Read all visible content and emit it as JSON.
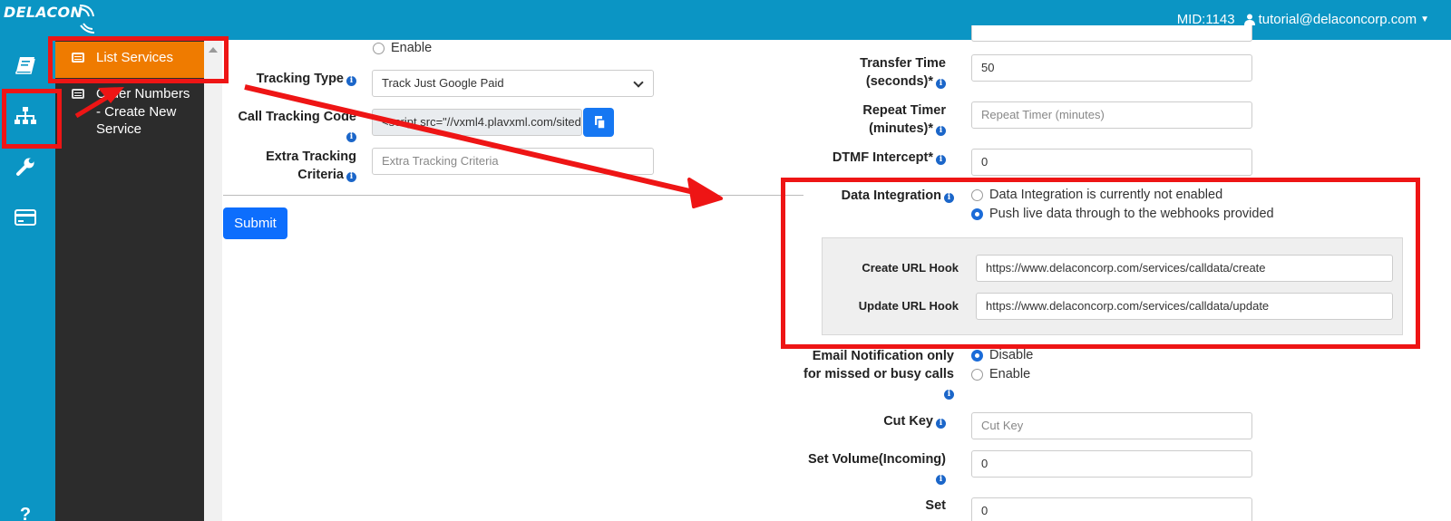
{
  "header": {
    "logo_text": "DELACON",
    "merchant_id": "MID:1143",
    "user_email": "tutorial@delaconcorp.com"
  },
  "rail": {
    "icons": [
      "book-icon",
      "sitemap-icon",
      "wrench-icon",
      "credit-card-icon",
      "help-icon"
    ]
  },
  "submenu": {
    "items": [
      {
        "label": "List Services",
        "active": true
      },
      {
        "label": "Order Numbers - Create New Service",
        "active": false
      }
    ]
  },
  "form_left": {
    "enable_option": "Enable",
    "tracking_type": {
      "label": "Tracking Type",
      "value": "Track Just Google Paid"
    },
    "call_tracking_code": {
      "label": "Call Tracking Code",
      "value": "<script src=\"//vxml4.plavxml.com/sited"
    },
    "extra_tracking": {
      "label": "Extra Tracking Criteria",
      "placeholder": "Extra Tracking Criteria"
    },
    "submit_label": "Submit"
  },
  "form_right": {
    "transfer_time": {
      "label": "Transfer Time (seconds)*",
      "value": "50"
    },
    "repeat_timer": {
      "label": "Repeat Timer (minutes)*",
      "placeholder": "Repeat Timer (minutes)"
    },
    "dtmf_intercept": {
      "label": "DTMF Intercept*",
      "value": "0"
    },
    "data_integration": {
      "label": "Data Integration",
      "options": [
        {
          "label": "Data Integration is currently not enabled",
          "checked": false
        },
        {
          "label": "Push live data through to the webhooks provided",
          "checked": true
        }
      ],
      "create_hook": {
        "label": "Create URL Hook",
        "value": "https://www.delaconcorp.com/services/calldata/create"
      },
      "update_hook": {
        "label": "Update URL Hook",
        "value": "https://www.delaconcorp.com/services/calldata/update"
      }
    },
    "email_notification": {
      "label": "Email Notification only for missed or busy calls",
      "options": [
        {
          "label": "Disable",
          "checked": true
        },
        {
          "label": "Enable",
          "checked": false
        }
      ]
    },
    "cut_key": {
      "label": "Cut Key",
      "placeholder": "Cut Key"
    },
    "set_volume_incoming": {
      "label": "Set Volume(Incoming)",
      "value": "0"
    },
    "set_next": {
      "label": "Set",
      "value": "0"
    }
  },
  "colors": {
    "brand": "#0b95c4",
    "active_menu": "#ef7b00",
    "primary_button": "#0d6efd",
    "annotation_red": "#ee1515"
  }
}
